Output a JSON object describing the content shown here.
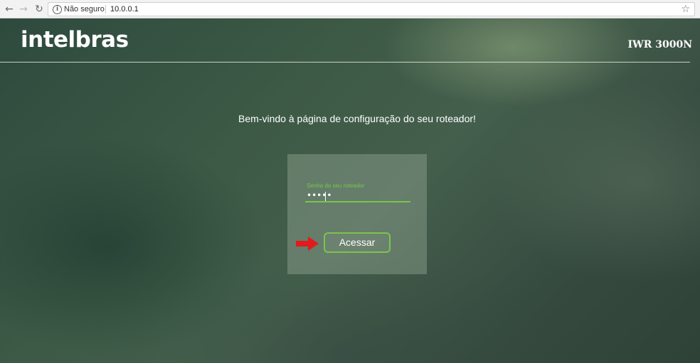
{
  "browser": {
    "back_icon": "←",
    "forward_icon": "→",
    "reload_icon": "↻",
    "info_icon": "i",
    "security_label": "Não seguro",
    "url": "10.0.0.1",
    "star_icon": "☆"
  },
  "header": {
    "logo_text": "intelbras",
    "model": "IWR 3000N"
  },
  "main": {
    "welcome": "Bem-vindo à página de configuração do seu roteador!",
    "password_label": "Senha do seu roteador",
    "password_value": "•••••",
    "submit_label": "Acessar"
  },
  "colors": {
    "accent": "#7cc44d",
    "arrow": "#e01b1b"
  }
}
